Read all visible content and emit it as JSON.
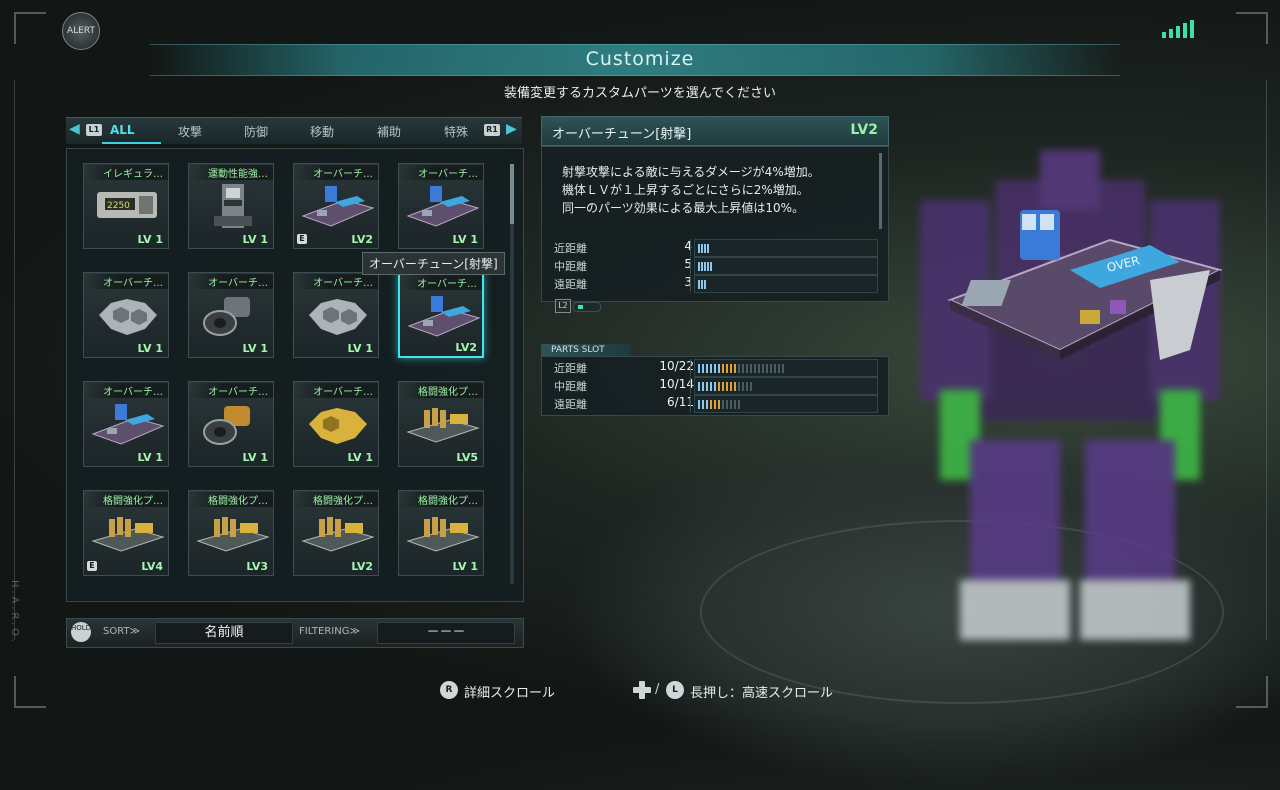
{
  "header": {
    "alert_label": "ALERT",
    "title": "Customize",
    "subtitle": "装備変更するカスタムパーツを選んでください"
  },
  "side_text": "H.A.R.O.",
  "tabs": {
    "left_button": "L1",
    "right_button": "R1",
    "items": [
      "ALL",
      "攻撃",
      "防御",
      "移動",
      "補助",
      "特殊"
    ],
    "active": "ALL"
  },
  "parts": [
    {
      "name": "イレギュラ…",
      "lv": "LV 1",
      "equipped": false,
      "icon": "chip-module-icon"
    },
    {
      "name": "運動性能強…",
      "lv": "LV 1",
      "equipped": false,
      "icon": "actuator-icon"
    },
    {
      "name": "オーバーチ…",
      "lv": "LV2",
      "equipped": true,
      "icon": "circuit-board-icon"
    },
    {
      "name": "オーバーチ…",
      "lv": "LV 1",
      "equipped": false,
      "icon": "circuit-board-icon"
    },
    {
      "name": "オーバーチ…",
      "lv": "LV 1",
      "equipped": false,
      "icon": "hex-plate-icon"
    },
    {
      "name": "オーバーチ…",
      "lv": "LV 1",
      "equipped": false,
      "icon": "thruster-icon"
    },
    {
      "name": "オーバーチ…",
      "lv": "LV 1",
      "equipped": false,
      "icon": "hex-plate-icon"
    },
    {
      "name": "オーバーチ…",
      "lv": "LV2",
      "equipped": false,
      "icon": "circuit-board-icon",
      "selected": true
    },
    {
      "name": "オーバーチ…",
      "lv": "LV 1",
      "equipped": false,
      "icon": "circuit-board-icon"
    },
    {
      "name": "オーバーチ…",
      "lv": "LV 1",
      "equipped": false,
      "icon": "thruster-icon"
    },
    {
      "name": "オーバーチ…",
      "lv": "LV 1",
      "equipped": false,
      "icon": "hex-plate-icon"
    },
    {
      "name": "格闘強化プ…",
      "lv": "LV5",
      "equipped": false,
      "icon": "melee-board-icon"
    },
    {
      "name": "格闘強化プ…",
      "lv": "LV4",
      "equipped": true,
      "icon": "melee-board-icon"
    },
    {
      "name": "格闘強化プ…",
      "lv": "LV3",
      "equipped": false,
      "icon": "melee-board-icon"
    },
    {
      "name": "格闘強化プ…",
      "lv": "LV2",
      "equipped": false,
      "icon": "melee-board-icon"
    },
    {
      "name": "格闘強化プ…",
      "lv": "LV 1",
      "equipped": false,
      "icon": "melee-board-icon"
    }
  ],
  "equipped_mark": "E",
  "tooltip": "オーバーチューン[射撃]",
  "sort_bar": {
    "hold_label": "HOLD",
    "sort_label": "SORT≫",
    "sort_value": "名前順",
    "filter_label": "FILTERING≫",
    "filter_value": "－－－"
  },
  "detail": {
    "name": "オーバーチューン[射撃]",
    "lv": "LV2",
    "description": "射撃攻撃による敵に与えるダメージが4%増加。\n機体ＬＶが１上昇するごとにさらに2%増加。\n同一のパーツ効果による最大上昇値は10%。",
    "stats": [
      {
        "label": "近距離",
        "value": "4",
        "ticks": 4
      },
      {
        "label": "中距離",
        "value": "5",
        "ticks": 5
      },
      {
        "label": "遠距離",
        "value": "3",
        "ticks": 3
      }
    ],
    "l2_label": "L2"
  },
  "parts_slot": {
    "label": "PARTS SLOT",
    "rows": [
      {
        "label": "近距離",
        "value": "10/22",
        "used": 10,
        "total": 22
      },
      {
        "label": "中距離",
        "value": "10/14",
        "used": 10,
        "total": 14
      },
      {
        "label": "遠距離",
        "value": "6/11",
        "used": 6,
        "total": 11
      }
    ]
  },
  "footer": {
    "hint1_button": "R",
    "hint1": "詳細スクロール",
    "hint2_button": "L",
    "hint2": "長押し：高速スクロール"
  },
  "colors": {
    "accent": "#3fe6f0",
    "level_green": "#a5f7b0",
    "bar_blue": "#8cc8f0",
    "bar_orange": "#e0a040",
    "bar_grey": "#4c5b5d"
  }
}
